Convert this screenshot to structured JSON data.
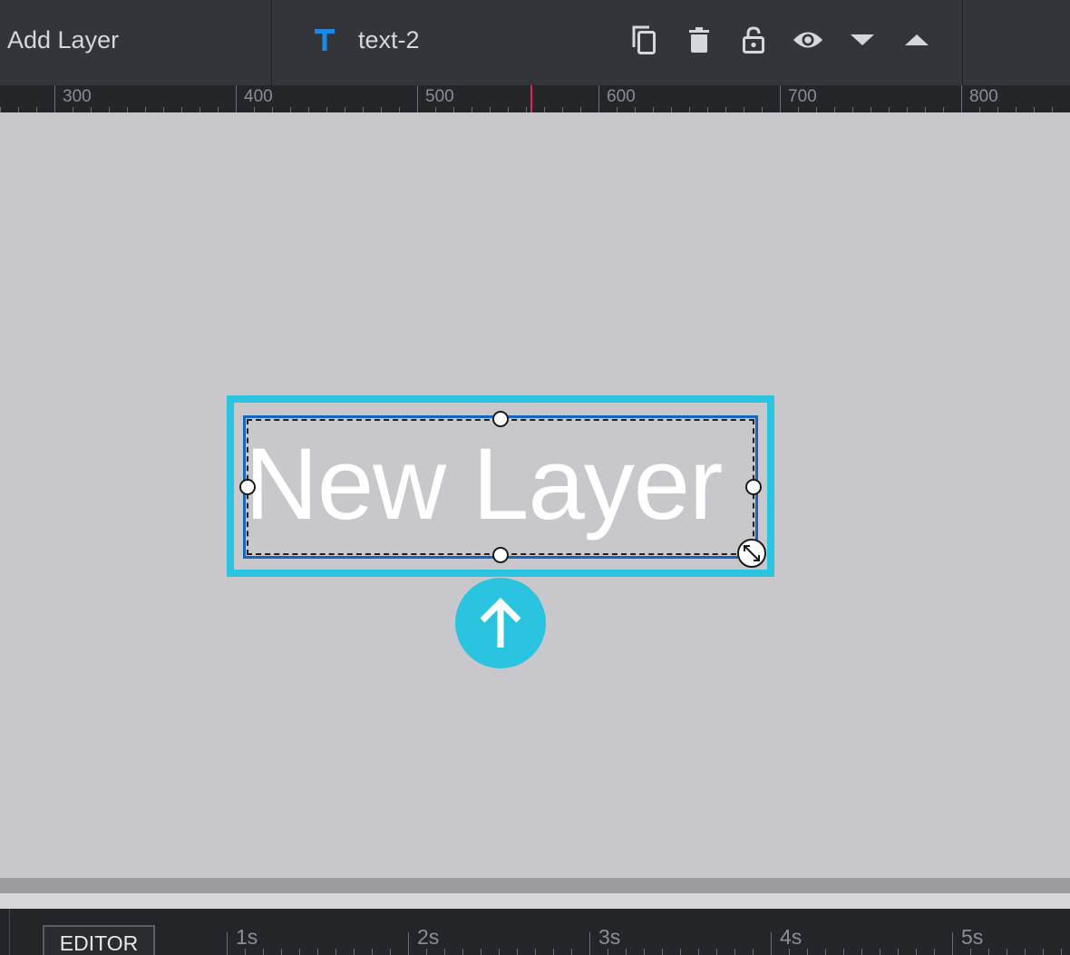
{
  "toolbar": {
    "add_layer_label": "Add Layer",
    "layer_type_icon": "text-type-icon",
    "layer_name": "text-2",
    "actions": [
      {
        "name": "duplicate-button",
        "icon": "copy-icon"
      },
      {
        "name": "delete-button",
        "icon": "trash-icon"
      },
      {
        "name": "lock-button",
        "icon": "lock-icon"
      },
      {
        "name": "visibility-button",
        "icon": "eye-icon"
      },
      {
        "name": "move-down-button",
        "icon": "caret-down-icon"
      },
      {
        "name": "move-up-button",
        "icon": "caret-up-icon"
      }
    ]
  },
  "ruler": {
    "labels": [
      "300",
      "400",
      "500",
      "600",
      "700",
      "800"
    ],
    "playhead_color": "#e91e63"
  },
  "canvas": {
    "layer_text": "New Layer",
    "selection_color": "#2ac3e0",
    "inner_border_color": "#1565c0",
    "up_button_icon": "arrow-up-icon"
  },
  "timeline": {
    "editor_tab_label": "EDITOR",
    "labels": [
      "1s",
      "2s",
      "3s",
      "4s",
      "5s"
    ]
  },
  "colors": {
    "toolbar_bg": "#33353a",
    "canvas_bg": "#c8c7cc",
    "accent": "#2ac3e0",
    "text_icon": "#1e88e5"
  }
}
